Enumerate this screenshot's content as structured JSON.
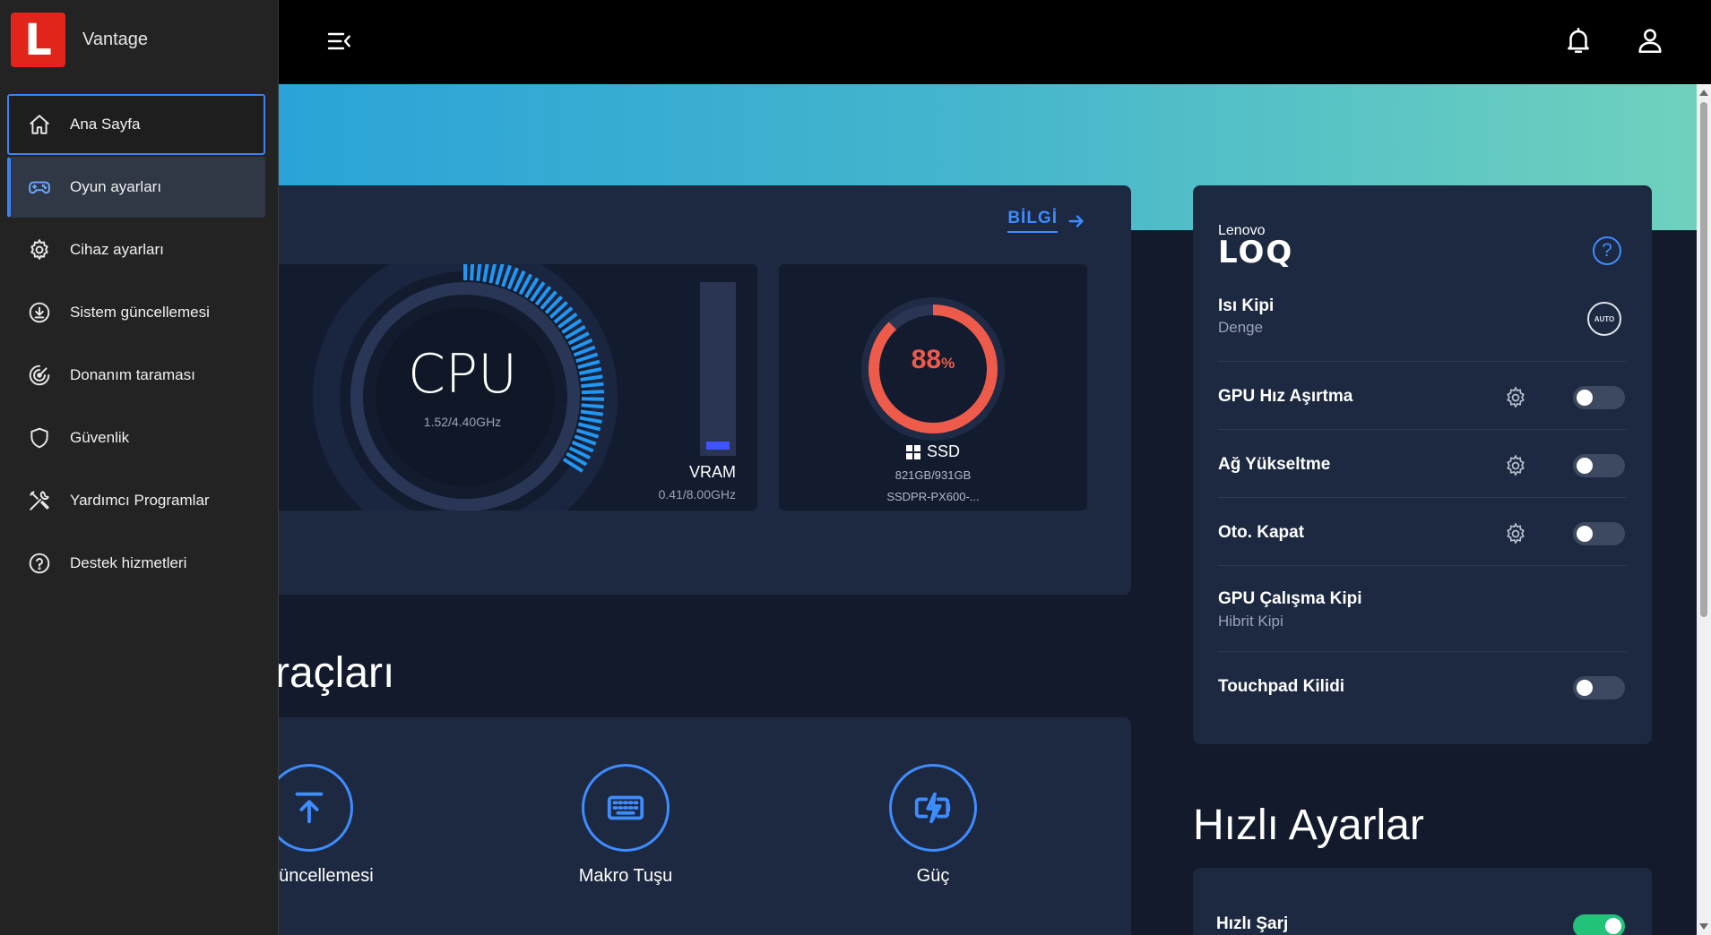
{
  "app": {
    "logo_letter": "L",
    "name": "Vantage"
  },
  "sidebar": {
    "items": [
      {
        "label": "Ana Sayfa",
        "icon": "home-icon"
      },
      {
        "label": "Oyun ayarları",
        "icon": "gamepad-icon"
      },
      {
        "label": "Cihaz ayarları",
        "icon": "gear-icon"
      },
      {
        "label": "Sistem güncellemesi",
        "icon": "download-icon"
      },
      {
        "label": "Donanım taraması",
        "icon": "scan-icon"
      },
      {
        "label": "Güvenlik",
        "icon": "shield-icon"
      },
      {
        "label": "Yardımcı Programlar",
        "icon": "tools-icon"
      },
      {
        "label": "Destek hizmetleri",
        "icon": "help-circle-icon"
      }
    ]
  },
  "performance": {
    "info_link": "BİLGİ",
    "cpu": {
      "label": "CPU",
      "freq": "1.52/4.40GHz",
      "gauge_level": 0.34
    },
    "vram": {
      "label": "VRAM",
      "value": "0.41/8.00GHz",
      "level": 0.05
    },
    "ssd": {
      "pct_value": "88",
      "pct_unit": "%",
      "usage": 0.88,
      "label": "SSD",
      "size": "821GB/931GB",
      "model": "SSDPR-PX600-..."
    }
  },
  "tools": {
    "title_partial": "raçları",
    "items": [
      {
        "label": "m Güncellemesi",
        "icon": "upload-icon"
      },
      {
        "label": "Makro Tuşu",
        "icon": "keyboard-icon"
      },
      {
        "label": "Güç",
        "icon": "battery-bolt-icon"
      }
    ]
  },
  "loq": {
    "brand_small": "Lenovo",
    "brand_big": "LOQ",
    "help_symbol": "?",
    "thermal": {
      "label": "Isı Kipi",
      "value": "Denge",
      "auto_label": "AUTO"
    },
    "rows": [
      {
        "label": "GPU Hız Aşırtma",
        "gear": true,
        "toggle": false
      },
      {
        "label": "Ağ Yükseltme",
        "gear": true,
        "toggle": false
      },
      {
        "label": "Oto. Kapat",
        "gear": true,
        "toggle": false
      }
    ],
    "gpu_mode": {
      "label": "GPU Çalışma Kipi",
      "value": "Hibrit Kipi"
    },
    "touchpad": {
      "label": "Touchpad Kilidi",
      "toggle": false
    }
  },
  "quick": {
    "title": "Hızlı Ayarlar",
    "items": [
      {
        "label": "Hızlı Şarj",
        "toggle": true
      }
    ]
  },
  "colors": {
    "accent": "#3f8cff",
    "brand_red": "#e1251b",
    "ssd_ring": "#ef5b4b",
    "toggle_on": "#22c27a",
    "cpu_gauge": "#2196f3"
  }
}
